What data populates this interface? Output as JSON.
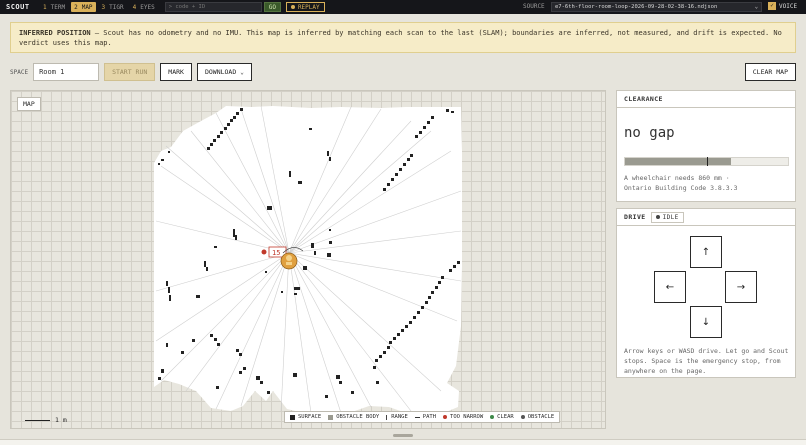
{
  "topbar": {
    "brand": "SCOUT",
    "tabs": [
      {
        "num": "1",
        "label": "TERM",
        "active": false
      },
      {
        "num": "2",
        "label": "MAP",
        "active": true
      },
      {
        "num": "3",
        "label": "TIGR",
        "active": false
      },
      {
        "num": "4",
        "label": "EYES",
        "active": false
      }
    ],
    "code_placeholder": "> code + ID",
    "go_label": "GO",
    "replay_label": "REPLAY",
    "source_label": "SOURCE",
    "source_value": "e7-6th-floor-room-loop-2026-09-28-02-38-16.ndjson",
    "voice_label": "VOICE"
  },
  "banner": {
    "title": "INFERRED POSITION",
    "text": " — Scout has no odometry and no IMU. This map is inferred by matching each scan to the last (SLAM); boundaries are inferred, not measured, and drift is expected. No verdict uses this map."
  },
  "controls": {
    "space_label": "SPACE",
    "space_value": "Room 1",
    "start_run": "START RUN",
    "mark": "MARK",
    "download": "DOWNLOAD",
    "clear_map": "CLEAR MAP"
  },
  "map": {
    "tag": "MAP",
    "robot_badge": "15",
    "scale_label": "1 m",
    "legend": {
      "surface": "SURFACE",
      "obstacle_body": "OBSTACLE BODY",
      "range": "RANGE",
      "path": "PATH",
      "too_narrow": "TOO NARROW",
      "clear": "CLEAR",
      "obstacle": "OBSTACLE"
    },
    "colors": {
      "too_narrow": "#c0392b",
      "clear": "#3f8a4a",
      "obstacle": "#555555",
      "robot": "#e0a040"
    }
  },
  "clearance": {
    "title": "CLEARANCE",
    "value": "no gap",
    "gauge_fill_fraction": 0.65,
    "gauge_marker_fraction": 0.5,
    "note_line1": "A wheelchair needs 860 mm ·",
    "note_line2": "Ontario Building Code 3.8.3.3"
  },
  "drive": {
    "title": "DRIVE",
    "status": "IDLE",
    "up": "↑",
    "left": "←",
    "right": "→",
    "down": "↓",
    "note": "Arrow keys or WASD drive. Let go and Scout stops. Space is the emergency stop, from anywhere on the page."
  }
}
